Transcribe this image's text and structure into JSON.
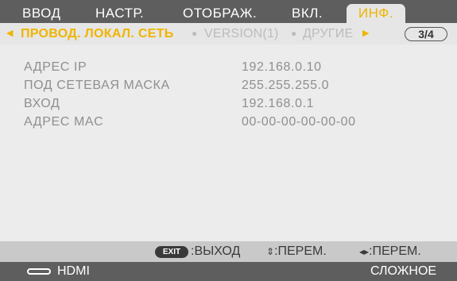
{
  "tabs": [
    {
      "label": "ВВОД",
      "active": false
    },
    {
      "label": "НАСТР.",
      "active": false
    },
    {
      "label": "ОТОБРАЖ.",
      "active": false
    },
    {
      "label": "ВКЛ.",
      "active": false
    },
    {
      "label": "ИНФ.",
      "active": true
    }
  ],
  "submenu": {
    "items": [
      {
        "label": "ПРОВОД. ЛОКАЛ. СЕТЬ",
        "active": true
      },
      {
        "label": "VERSION(1)",
        "active": false
      },
      {
        "label": "ДРУГИЕ",
        "active": false
      }
    ],
    "page_indicator": "3/4"
  },
  "info": [
    {
      "label": "АДРЕС IP",
      "value": "192.168.0.10"
    },
    {
      "label": "ПОД СЕТЕВАЯ МАСКА",
      "value": "255.255.255.0"
    },
    {
      "label": "ВХОД",
      "value": "192.168.0.1"
    },
    {
      "label": "АДРЕС MAC",
      "value": "00-00-00-00-00-00"
    }
  ],
  "help": {
    "exit_key": "EXIT",
    "exit_label": ":ВЫХОД",
    "updown_glyph": "⇕",
    "updown_label": ":ПЕРЕМ.",
    "leftright_glyph": "◂▸",
    "leftright_label": ":ПЕРЕМ."
  },
  "status": {
    "input_icon": "hdmi-connector-icon",
    "input_label": "HDMI",
    "mode_label": "СЛОЖНОЕ"
  },
  "colors": {
    "accent": "#f0b400",
    "bar": "#5e5e5e",
    "panel": "#ececec",
    "inactive_text": "#bcbcbc",
    "value_text": "#8f8f8f"
  }
}
